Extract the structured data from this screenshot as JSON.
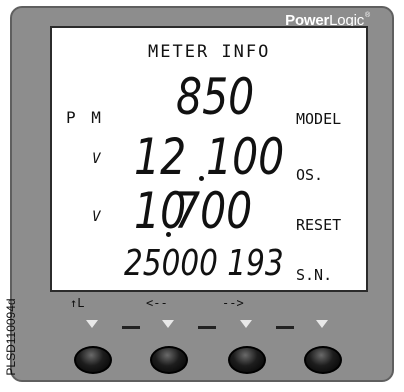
{
  "brand": {
    "strong": "Power",
    "light": "Logic",
    "mark": "®"
  },
  "display": {
    "title": "METER INFO",
    "model_prefix": "P M",
    "model_value": "850",
    "os_prefix": "V",
    "os_int": "12",
    "os_frac": "100",
    "reset_prefix": "V",
    "reset_int": "10",
    "reset_frac": "700",
    "serial_value": "25000 193",
    "right_labels": {
      "model": "MODEL",
      "os": "OS.",
      "reset": "RESET",
      "serial": "S.N."
    }
  },
  "softkeys": {
    "k1": "↑L",
    "k2": "<--",
    "k3": "-->"
  },
  "side_code": "PLSD110094d"
}
